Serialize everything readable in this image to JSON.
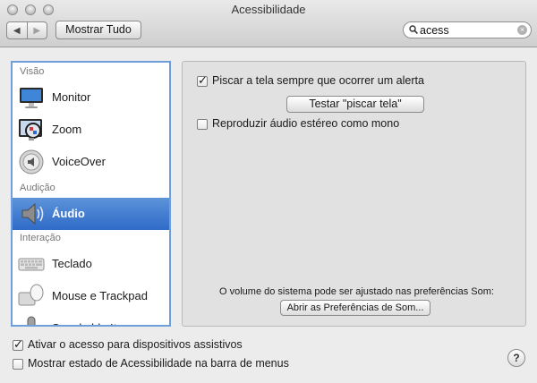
{
  "window": {
    "title": "Acessibilidade"
  },
  "toolbar": {
    "back_glyph": "◀",
    "forward_glyph": "▶",
    "show_all_label": "Mostrar Tudo",
    "search_value": "acess",
    "search_clear_glyph": "×"
  },
  "sidebar": {
    "sections": [
      {
        "label": "Visão"
      },
      {
        "label": "Audição"
      },
      {
        "label": "Interação"
      }
    ],
    "items": [
      {
        "label": "Monitor",
        "icon": "monitor-icon"
      },
      {
        "label": "Zoom",
        "icon": "zoom-icon"
      },
      {
        "label": "VoiceOver",
        "icon": "voiceover-icon"
      },
      {
        "label": "Áudio",
        "icon": "speaker-icon",
        "selected": true
      },
      {
        "label": "Teclado",
        "icon": "keyboard-icon"
      },
      {
        "label": "Mouse e Trackpad",
        "icon": "mouse-icon"
      },
      {
        "label": "Speakable Items",
        "icon": "microphone-icon"
      }
    ]
  },
  "main": {
    "flash_screen_label": "Piscar a tela sempre que ocorrer um alerta",
    "flash_screen_checked": true,
    "test_flash_button": "Testar \"piscar tela\"",
    "mono_audio_label": "Reproduzir áudio estéreo como mono",
    "mono_audio_checked": false,
    "volume_note": "O volume do sistema pode ser ajustado nas preferências Som:",
    "open_sound_prefs_button": "Abrir as Preferências de Som..."
  },
  "footer": {
    "assistive_devices_label": "Ativar o acesso para dispositivos assistivos",
    "assistive_devices_checked": true,
    "menu_bar_status_label": "Mostrar estado de Acessibilidade na barra de menus",
    "menu_bar_status_checked": false,
    "help_glyph": "?"
  },
  "colors": {
    "selection": "#3a78cf",
    "focus_ring": "#6f9fda",
    "panel_bg": "#e1e1e1"
  }
}
